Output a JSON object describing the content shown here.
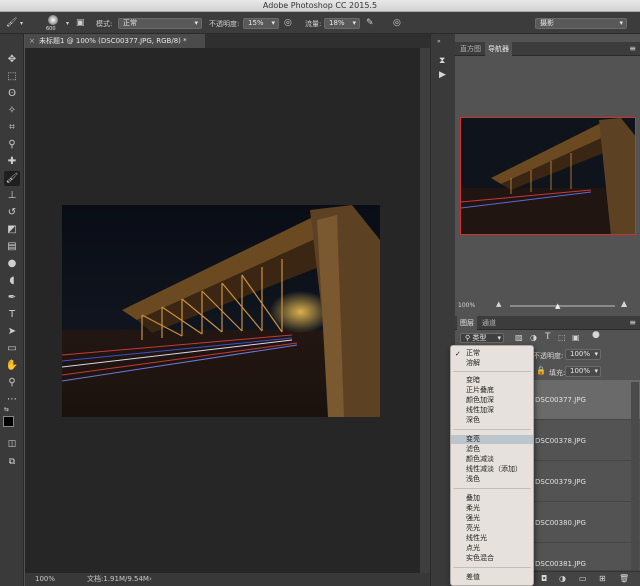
{
  "app": {
    "title": "Adobe Photoshop CC 2015.5"
  },
  "options_bar": {
    "brush_size": "600",
    "mode_label": "模式:",
    "mode_value": "正常",
    "opacity_label": "不透明度:",
    "opacity_value": "15%",
    "flow_label": "流量:",
    "flow_value": "18%",
    "workspace": "摄影"
  },
  "document": {
    "tab_title": "未标题1 @ 100% (DSC00377.JPG, RGB/8) *",
    "zoom": "100%",
    "doc_size": "文档:1.91M/9.54M"
  },
  "navigator": {
    "tabs": [
      "直方图",
      "导航器"
    ],
    "selected_tab": 1,
    "zoom": "100%"
  },
  "layers_panel": {
    "tabs": [
      "图层",
      "通道"
    ],
    "selected_tab": 0,
    "filter_kind": "类型",
    "opacity_label": "不透明度:",
    "opacity_value": "100%",
    "fill_label": "填充:",
    "fill_value": "100%",
    "layers": [
      "DSC00377.JPG",
      "DSC00378.JPG",
      "DSC00379.JPG",
      "DSC00380.JPG",
      "DSC00381.JPG"
    ]
  },
  "blend_menu": {
    "checked": "正常",
    "highlighted": "变亮",
    "groups": [
      [
        "正常",
        "溶解"
      ],
      [
        "变暗",
        "正片叠底",
        "颜色加深",
        "线性加深",
        "深色"
      ],
      [
        "变亮",
        "滤色",
        "颜色减淡",
        "线性减淡（添加）",
        "浅色"
      ],
      [
        "叠加",
        "柔光",
        "强光",
        "亮光",
        "线性光",
        "点光",
        "实色混合"
      ],
      [
        "差值"
      ]
    ]
  },
  "colors": {
    "accent_red": "#d03030",
    "panel_bg": "#535353",
    "canvas_bg": "#262626",
    "menu_bg": "#e6e1dc",
    "menu_highlight": "#bcc4cc"
  }
}
